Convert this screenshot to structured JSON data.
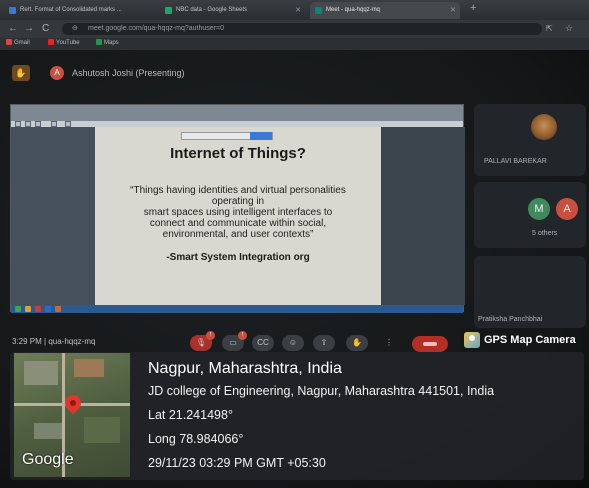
{
  "browser": {
    "tabs": [
      {
        "label": "Rert. Format of Consolidated marks ...",
        "active": false
      },
      {
        "label": "NBC data - Google Sheets",
        "active": false
      },
      {
        "label": "Meet - qua-hqqz-mq",
        "active": true
      }
    ],
    "new_tab_symbol": "+",
    "url": "meet.google.com/qua-hqqz-mq?authuser=0",
    "bookmarks": [
      "Gmail",
      "YouTube",
      "Maps"
    ]
  },
  "meet": {
    "presenter_label": "Ashutosh Joshi (Presenting)",
    "presenter_initial": "A",
    "participants": {
      "pallavi": "PALLAVI BAREKAR",
      "others_count": "5 others",
      "others_initials": [
        "M",
        "A"
      ],
      "pratiksha": "Pratiksha Panchbhai"
    },
    "meeting_time_code": "3:29 PM  |  qua-hqqz-mq",
    "colors": {
      "leave_button": "#b32e25",
      "avatar_red": "#c9503f",
      "avatar_green": "#3f8a5c"
    }
  },
  "slide": {
    "title": "Internet of Things?",
    "body_lines": [
      "“Things having identities and virtual personalities",
      "operating in",
      "smart spaces using intelligent interfaces to",
      "connect and communicate within social,",
      "environmental, and user contexts”"
    ],
    "source": "-Smart System Integration org"
  },
  "gps": {
    "app_badge": "GPS Map Camera",
    "map_brand": "Google",
    "title": "Nagpur, Maharashtra, India",
    "address": "JD college of Engineering, Nagpur, Maharashtra 441501, India",
    "lat": "Lat 21.241498°",
    "long": "Long 78.984066°",
    "datetime": "29/11/23 03:29 PM GMT +05:30"
  }
}
